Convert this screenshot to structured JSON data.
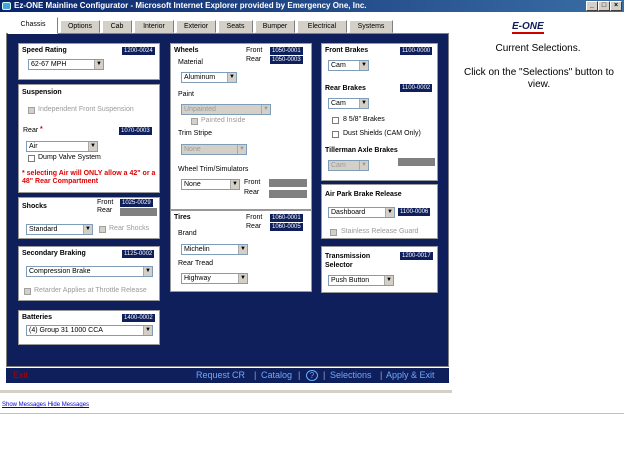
{
  "window": {
    "title": "Ez-ONE Mainline Configurator - Microsoft Internet Explorer provided by Emergency One, Inc.",
    "min": "_",
    "max": "□",
    "close": "×"
  },
  "tabs": [
    "Chassis",
    "Options",
    "Cab",
    "Interior",
    "Exterior",
    "Seats",
    "Bumper",
    "Electrical",
    "Systems"
  ],
  "speed": {
    "title": "Speed Rating",
    "code": "1200-0024",
    "value": "62-67 MPH"
  },
  "suspension": {
    "title": "Suspension",
    "ifs": "Independent Front Suspension",
    "rear_label": "Rear",
    "req": "*",
    "code": "1070-0003",
    "rear_value": "Air",
    "dump": "Dump Valve System",
    "warning": "* selecting Air will ONLY allow a 42\" or a 48\" Rear Compartment"
  },
  "shocks": {
    "title": "Shocks",
    "front": "Front",
    "rear": "Rear",
    "front_code": "1025-0029",
    "value": "Standard",
    "rear_shocks": "Rear Shocks"
  },
  "secondary": {
    "title": "Secondary Braking",
    "code": "1125-0002",
    "value": "Compression Brake",
    "retarder": "Retarder Applies at Throttle Release"
  },
  "batteries": {
    "title": "Batteries",
    "code": "1400-0002",
    "value": "(4) Group 31 1000 CCA"
  },
  "wheels": {
    "title": "Wheels",
    "front": "Front",
    "rear": "Rear",
    "front_code": "1050-0001",
    "rear_code": "1050-0003",
    "material_label": "Material",
    "material": "Aluminum",
    "paint_label": "Paint",
    "paint": "Unpainted",
    "painted_inside": "Painted Inside",
    "trim_label": "Trim Stripe",
    "trim": "None",
    "sim_label": "Wheel Trim/Simulators",
    "sim": "None",
    "sim_front": "Front",
    "sim_rear": "Rear"
  },
  "tires": {
    "title": "Tires",
    "front": "Front",
    "rear": "Rear",
    "front_code": "1060-0001",
    "rear_code": "1060-0005",
    "brand_label": "Brand",
    "brand": "Michelin",
    "tread_label": "Rear Tread",
    "tread": "Highway"
  },
  "front_brakes": {
    "title": "Front Brakes",
    "code": "1100-0000",
    "value": "Cam"
  },
  "rear_brakes": {
    "title": "Rear Brakes",
    "code": "1100-0002",
    "value": "Cam",
    "opt1": "8 5/8\" Brakes",
    "opt2": "Dust Shields (CAM Only)"
  },
  "tillerman": {
    "title": "Tillerman Axle Brakes",
    "value": "Cam"
  },
  "airpark": {
    "title": "Air Park Brake Release",
    "value": "Dashboard",
    "code": "1100-0006",
    "guard": "Stainless Release Guard"
  },
  "transmission": {
    "title": "Transmission Selector",
    "code": "1200-0017",
    "value": "Push Button"
  },
  "footer": {
    "exit": "Exit",
    "request": "Request CR",
    "sep1": "|",
    "catalog": "Catalog",
    "sep2": "|",
    "help": "?",
    "sep3": "|",
    "selections": "Selections",
    "sep4": "|",
    "apply": "Apply & Exit"
  },
  "side": {
    "logo": "E-ONE",
    "heading": "Current Selections.",
    "text": "Click on the \"Selections\" button to view."
  },
  "messages": {
    "show": "Show Messages",
    "hide": "Hide Messages"
  }
}
